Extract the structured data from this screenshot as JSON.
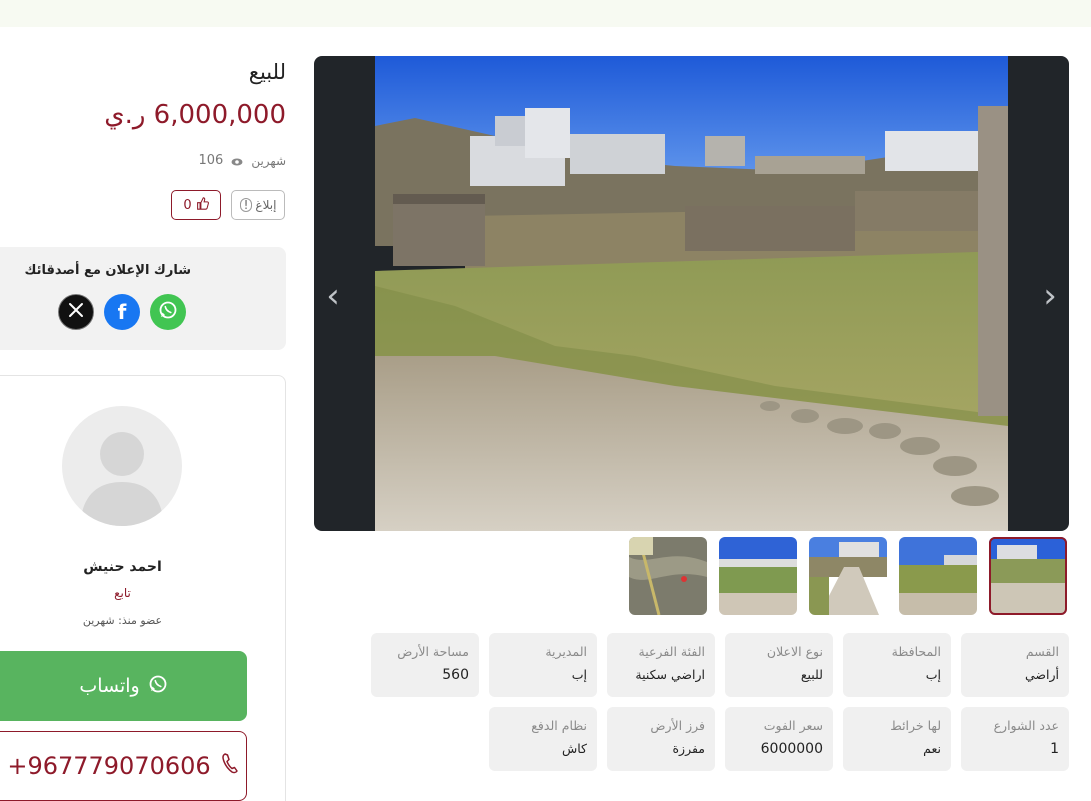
{
  "listing": {
    "title": "للبيع",
    "price": "6,000,000 ر.ي",
    "posted": "شهرين",
    "views": "106",
    "report_label": "إبلاغ",
    "likes": "0"
  },
  "share": {
    "title": "شارك الإعلان مع أصدقائك",
    "networks": [
      "x-icon",
      "facebook-icon",
      "whatsapp-icon"
    ]
  },
  "seller": {
    "name": "احمد حنيش",
    "role": "تابع",
    "member_since": "عضو منذ: شهرين",
    "whatsapp_label": "واتساب",
    "phone": "+967779070606"
  },
  "gallery": {
    "prev_icon": "‹",
    "next_icon": "›",
    "thumbnail_count": 5,
    "active_thumbnail": 1
  },
  "specs": [
    {
      "key": "القسم",
      "value": "أراضي"
    },
    {
      "key": "المحافظة",
      "value": "إب"
    },
    {
      "key": "نوع الاعلان",
      "value": "للبيع"
    },
    {
      "key": "الفئة الفرعية",
      "value": "اراضي سكنية"
    },
    {
      "key": "المديرية",
      "value": "إب"
    },
    {
      "key": "مساحة الأرض",
      "value": "560"
    },
    {
      "key": "عدد الشوارع",
      "value": "1"
    },
    {
      "key": "لها خرائط",
      "value": "نعم"
    },
    {
      "key": "سعر الفوت",
      "value": "6000000"
    },
    {
      "key": "فرز الأرض",
      "value": "مفرزة"
    },
    {
      "key": "نظام الدفع",
      "value": "كاش"
    }
  ],
  "colors": {
    "accent": "#8e1a2a",
    "whatsapp": "#58b45f",
    "facebook": "#1877f2",
    "spec_bg": "#f0f0f0"
  }
}
